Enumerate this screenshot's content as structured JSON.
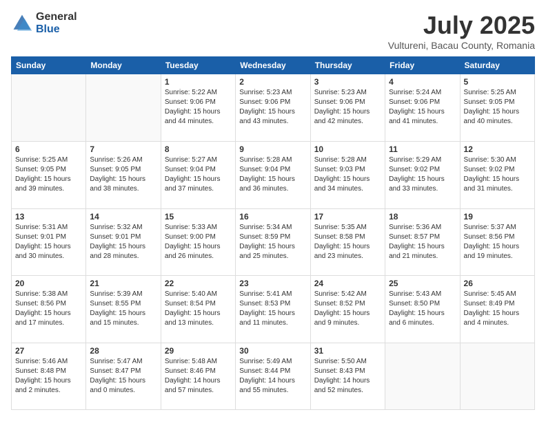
{
  "logo": {
    "general": "General",
    "blue": "Blue"
  },
  "title": "July 2025",
  "subtitle": "Vultureni, Bacau County, Romania",
  "headers": [
    "Sunday",
    "Monday",
    "Tuesday",
    "Wednesday",
    "Thursday",
    "Friday",
    "Saturday"
  ],
  "weeks": [
    [
      {
        "num": "",
        "info": ""
      },
      {
        "num": "",
        "info": ""
      },
      {
        "num": "1",
        "info": "Sunrise: 5:22 AM\nSunset: 9:06 PM\nDaylight: 15 hours\nand 44 minutes."
      },
      {
        "num": "2",
        "info": "Sunrise: 5:23 AM\nSunset: 9:06 PM\nDaylight: 15 hours\nand 43 minutes."
      },
      {
        "num": "3",
        "info": "Sunrise: 5:23 AM\nSunset: 9:06 PM\nDaylight: 15 hours\nand 42 minutes."
      },
      {
        "num": "4",
        "info": "Sunrise: 5:24 AM\nSunset: 9:06 PM\nDaylight: 15 hours\nand 41 minutes."
      },
      {
        "num": "5",
        "info": "Sunrise: 5:25 AM\nSunset: 9:05 PM\nDaylight: 15 hours\nand 40 minutes."
      }
    ],
    [
      {
        "num": "6",
        "info": "Sunrise: 5:25 AM\nSunset: 9:05 PM\nDaylight: 15 hours\nand 39 minutes."
      },
      {
        "num": "7",
        "info": "Sunrise: 5:26 AM\nSunset: 9:05 PM\nDaylight: 15 hours\nand 38 minutes."
      },
      {
        "num": "8",
        "info": "Sunrise: 5:27 AM\nSunset: 9:04 PM\nDaylight: 15 hours\nand 37 minutes."
      },
      {
        "num": "9",
        "info": "Sunrise: 5:28 AM\nSunset: 9:04 PM\nDaylight: 15 hours\nand 36 minutes."
      },
      {
        "num": "10",
        "info": "Sunrise: 5:28 AM\nSunset: 9:03 PM\nDaylight: 15 hours\nand 34 minutes."
      },
      {
        "num": "11",
        "info": "Sunrise: 5:29 AM\nSunset: 9:02 PM\nDaylight: 15 hours\nand 33 minutes."
      },
      {
        "num": "12",
        "info": "Sunrise: 5:30 AM\nSunset: 9:02 PM\nDaylight: 15 hours\nand 31 minutes."
      }
    ],
    [
      {
        "num": "13",
        "info": "Sunrise: 5:31 AM\nSunset: 9:01 PM\nDaylight: 15 hours\nand 30 minutes."
      },
      {
        "num": "14",
        "info": "Sunrise: 5:32 AM\nSunset: 9:01 PM\nDaylight: 15 hours\nand 28 minutes."
      },
      {
        "num": "15",
        "info": "Sunrise: 5:33 AM\nSunset: 9:00 PM\nDaylight: 15 hours\nand 26 minutes."
      },
      {
        "num": "16",
        "info": "Sunrise: 5:34 AM\nSunset: 8:59 PM\nDaylight: 15 hours\nand 25 minutes."
      },
      {
        "num": "17",
        "info": "Sunrise: 5:35 AM\nSunset: 8:58 PM\nDaylight: 15 hours\nand 23 minutes."
      },
      {
        "num": "18",
        "info": "Sunrise: 5:36 AM\nSunset: 8:57 PM\nDaylight: 15 hours\nand 21 minutes."
      },
      {
        "num": "19",
        "info": "Sunrise: 5:37 AM\nSunset: 8:56 PM\nDaylight: 15 hours\nand 19 minutes."
      }
    ],
    [
      {
        "num": "20",
        "info": "Sunrise: 5:38 AM\nSunset: 8:56 PM\nDaylight: 15 hours\nand 17 minutes."
      },
      {
        "num": "21",
        "info": "Sunrise: 5:39 AM\nSunset: 8:55 PM\nDaylight: 15 hours\nand 15 minutes."
      },
      {
        "num": "22",
        "info": "Sunrise: 5:40 AM\nSunset: 8:54 PM\nDaylight: 15 hours\nand 13 minutes."
      },
      {
        "num": "23",
        "info": "Sunrise: 5:41 AM\nSunset: 8:53 PM\nDaylight: 15 hours\nand 11 minutes."
      },
      {
        "num": "24",
        "info": "Sunrise: 5:42 AM\nSunset: 8:52 PM\nDaylight: 15 hours\nand 9 minutes."
      },
      {
        "num": "25",
        "info": "Sunrise: 5:43 AM\nSunset: 8:50 PM\nDaylight: 15 hours\nand 6 minutes."
      },
      {
        "num": "26",
        "info": "Sunrise: 5:45 AM\nSunset: 8:49 PM\nDaylight: 15 hours\nand 4 minutes."
      }
    ],
    [
      {
        "num": "27",
        "info": "Sunrise: 5:46 AM\nSunset: 8:48 PM\nDaylight: 15 hours\nand 2 minutes."
      },
      {
        "num": "28",
        "info": "Sunrise: 5:47 AM\nSunset: 8:47 PM\nDaylight: 15 hours\nand 0 minutes."
      },
      {
        "num": "29",
        "info": "Sunrise: 5:48 AM\nSunset: 8:46 PM\nDaylight: 14 hours\nand 57 minutes."
      },
      {
        "num": "30",
        "info": "Sunrise: 5:49 AM\nSunset: 8:44 PM\nDaylight: 14 hours\nand 55 minutes."
      },
      {
        "num": "31",
        "info": "Sunrise: 5:50 AM\nSunset: 8:43 PM\nDaylight: 14 hours\nand 52 minutes."
      },
      {
        "num": "",
        "info": ""
      },
      {
        "num": "",
        "info": ""
      }
    ]
  ]
}
